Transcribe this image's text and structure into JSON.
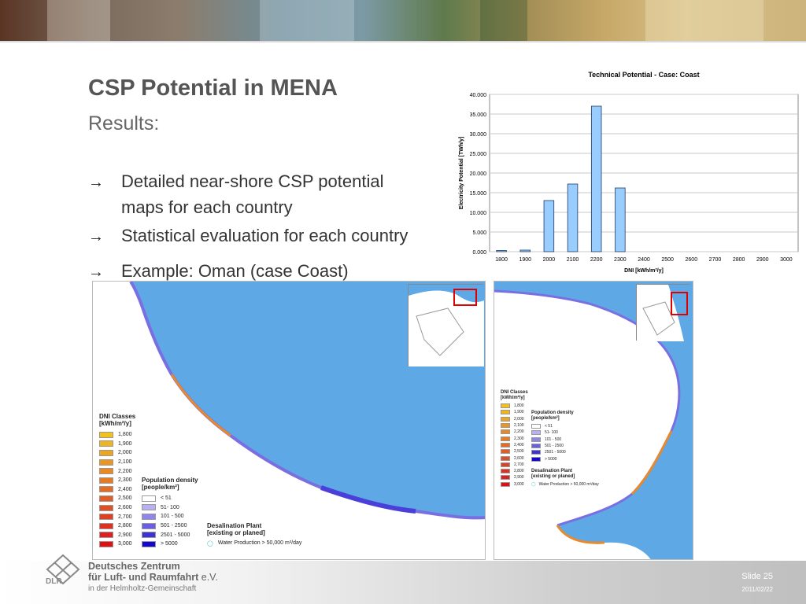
{
  "slide": {
    "title": "CSP Potential in MENA",
    "subtitle": "Results:",
    "bullets": [
      {
        "line1": "Detailed near-shore CSP potential",
        "line2": "maps for each country"
      },
      {
        "text": "Statistical evaluation for each country"
      },
      {
        "text": "Example: Oman (case Coast)"
      }
    ],
    "bullet_arrow": "→"
  },
  "chart_data": {
    "type": "bar",
    "title": "Technical Potential - Case: Coast",
    "xlabel": "DNI [kWh/m²/y]",
    "ylabel": "Electricity Potential [TWh/y]",
    "ylim": [
      0,
      40000
    ],
    "yticks": [
      "0.000",
      "5.000",
      "10.000",
      "15.000",
      "20.000",
      "25.000",
      "30.000",
      "35.000",
      "40.000"
    ],
    "categories": [
      "1800",
      "1900",
      "2000",
      "2100",
      "2200",
      "2300",
      "2400",
      "2500",
      "2600",
      "2700",
      "2800",
      "2900",
      "3000"
    ],
    "values": [
      300,
      400,
      13000,
      17200,
      37000,
      16200,
      0,
      0,
      0,
      0,
      0,
      0,
      0
    ],
    "bar_color": "#99ccff",
    "grid": true
  },
  "maps": {
    "dni_legend_title_1": "DNI Classes",
    "dni_legend_title_2": "[kWh/m²/y]",
    "dni_classes": [
      {
        "label": "1,800",
        "color": "#f2c21a"
      },
      {
        "label": "1,900",
        "color": "#f0b41c"
      },
      {
        "label": "2,000",
        "color": "#eea51e"
      },
      {
        "label": "2,100",
        "color": "#ec9620"
      },
      {
        "label": "2,200",
        "color": "#ea8822"
      },
      {
        "label": "2,300",
        "color": "#e87a22"
      },
      {
        "label": "2,400",
        "color": "#e66c22"
      },
      {
        "label": "2,500",
        "color": "#e45e22"
      },
      {
        "label": "2,600",
        "color": "#e24f22"
      },
      {
        "label": "2,700",
        "color": "#e04022"
      },
      {
        "label": "2,800",
        "color": "#e03020"
      },
      {
        "label": "2,900",
        "color": "#e02020"
      },
      {
        "label": "3,000",
        "color": "#e01010"
      }
    ],
    "pop_legend_title_1": "Population density",
    "pop_legend_title_2": "[people/km²]",
    "pop_classes": [
      {
        "label": "< 51",
        "color": "#ffffff"
      },
      {
        "label": "51- 100",
        "color": "#b8b0f0"
      },
      {
        "label": "101 - 500",
        "color": "#8f86ea"
      },
      {
        "label": "501 - 2500",
        "color": "#6a5fe0"
      },
      {
        "label": "2501 - 5000",
        "color": "#3d32d6"
      },
      {
        "label": "> 5000",
        "color": "#1408cc"
      }
    ],
    "desal_title_1": "Desalination Plant",
    "desal_title_2": "[existing or planed]",
    "desal_item": "Water Production > 50,000 m³/day",
    "sea_color": "#5ea8e6",
    "land_color": "#ffffff",
    "highlight_color": "#e00000"
  },
  "footer": {
    "logo_text": "DLR",
    "org_line1": "Deutsches Zentrum",
    "org_line2": "für Luft- und Raumfahrt",
    "org_line2_suffix": " e.V.",
    "org_line3": "in der Helmholtz-Gemeinschaft",
    "slide_label": "Slide 25",
    "date": "2011/02/22"
  }
}
